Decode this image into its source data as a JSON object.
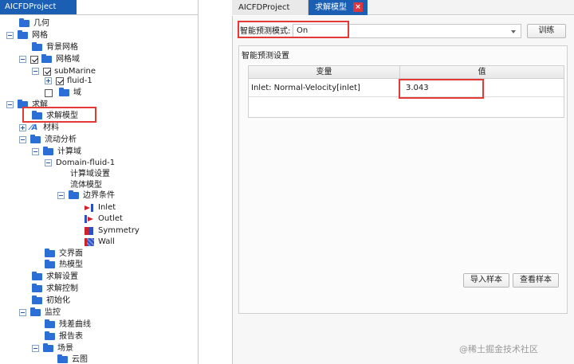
{
  "left": {
    "tab_label": "AICFDProject",
    "tree": {
      "geometry": "几何",
      "mesh": "网格",
      "background_mesh": "背景网格",
      "mesh_domain": "网格域",
      "submarine": "subMarine",
      "fluid1": "fluid-1",
      "domain": "域",
      "solve": "求解",
      "solver_model": "求解模型",
      "materials": "材料",
      "flow_analysis": "流动分析",
      "compute_domain": "计算域",
      "domain_fluid1": "Domain-fluid-1",
      "compute_domain_settings": "计算域设置",
      "fluid_model": "流体模型",
      "boundary_conditions": "边界条件",
      "inlet": "Inlet",
      "outlet": "Outlet",
      "symmetry": "Symmetry",
      "wall": "Wall",
      "interface": "交界面",
      "thermal_model": "热模型",
      "solve_settings": "求解设置",
      "solve_control": "求解控制",
      "initialization": "初始化",
      "monitor": "监控",
      "residual_curve": "残差曲线",
      "report_table": "报告表",
      "scene": "场景",
      "contour": "云图"
    }
  },
  "right": {
    "tabs": {
      "project": "AICFDProject",
      "solver_model": "求解模型"
    },
    "mode_label": "智能预测模式:",
    "mode_value": "On",
    "train_button": "训练",
    "group_title": "智能预测设置",
    "table": {
      "headers": [
        "变量",
        "值"
      ],
      "rows": [
        {
          "variable": "Inlet: Normal-Velocity[inlet]",
          "value": "3.043"
        }
      ]
    },
    "import_button": "导入样本",
    "view_button": "查看样本"
  },
  "watermark": "@稀土掘金技术社区",
  "colors": {
    "tab_active": "#1a5fb4",
    "highlight_red": "#e53935",
    "tree_icon_blue": "#2b6fd6"
  }
}
